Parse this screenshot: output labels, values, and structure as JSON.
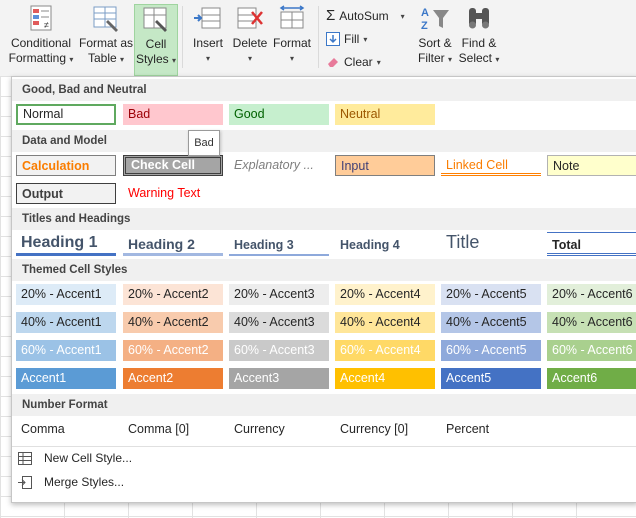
{
  "ribbon": {
    "conditional_formatting": {
      "line1": "Conditional",
      "line2": "Formatting"
    },
    "format_as_table": {
      "line1": "Format as",
      "line2": "Table"
    },
    "cell_styles": {
      "line1": "Cell",
      "line2": "Styles"
    },
    "insert": "Insert",
    "delete": "Delete",
    "format": "Format",
    "autosum": "AutoSum",
    "fill": "Fill",
    "clear": "Clear",
    "sort_filter": {
      "line1": "Sort &",
      "line2": "Filter"
    },
    "find_select": {
      "line1": "Find &",
      "line2": "Select"
    }
  },
  "sections": {
    "good_bad_neutral": "Good, Bad and Neutral",
    "data_model": "Data and Model",
    "titles_headings": "Titles and Headings",
    "themed": "Themed Cell Styles",
    "number_format": "Number Format"
  },
  "good_bad": [
    "Normal",
    "Bad",
    "Good",
    "Neutral"
  ],
  "data_model": {
    "row1": [
      "Calculation",
      "Check Cell",
      "Explanatory ...",
      "Input",
      "Linked Cell",
      "Note"
    ],
    "row2": [
      "Output",
      "Warning Text"
    ]
  },
  "headings": [
    "Heading 1",
    "Heading 2",
    "Heading 3",
    "Heading 4",
    "Title",
    "Total"
  ],
  "themed": {
    "row20": [
      "20% - Accent1",
      "20% - Accent2",
      "20% - Accent3",
      "20% - Accent4",
      "20% - Accent5",
      "20% - Accent6"
    ],
    "row40": [
      "40% - Accent1",
      "40% - Accent2",
      "40% - Accent3",
      "40% - Accent4",
      "40% - Accent5",
      "40% - Accent6"
    ],
    "row60": [
      "60% - Accent1",
      "60% - Accent2",
      "60% - Accent3",
      "60% - Accent4",
      "60% - Accent5",
      "60% - Accent6"
    ],
    "accent": [
      "Accent1",
      "Accent2",
      "Accent3",
      "Accent4",
      "Accent5",
      "Accent6"
    ]
  },
  "number_format": [
    "Comma",
    "Comma [0]",
    "Currency",
    "Currency [0]",
    "Percent"
  ],
  "menu": {
    "new_cell_style": "New Cell Style...",
    "merge_styles": "Merge Styles..."
  },
  "tooltip": "Bad",
  "colors": {
    "accent1": "#5b9bd5",
    "accent2": "#ed7d31",
    "accent3": "#a5a5a5",
    "accent4": "#ffc000",
    "accent5": "#4472c4",
    "accent6": "#70ad47",
    "bad_fill": "#ffc7ce",
    "good_fill": "#c6efce",
    "neutral_fill": "#ffeb9c"
  }
}
